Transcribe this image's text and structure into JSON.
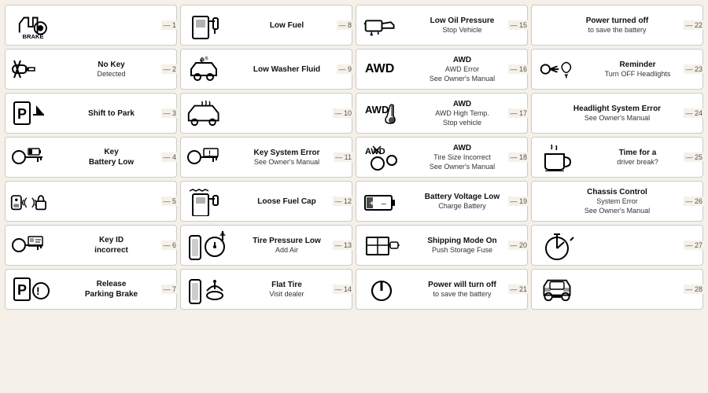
{
  "columns": [
    {
      "items": [
        {
          "id": 1,
          "icon": "brake",
          "label": "BRAKE",
          "sub": ""
        },
        {
          "id": 2,
          "icon": "nokey",
          "label": "No Key",
          "sub": "Detected"
        },
        {
          "id": 3,
          "icon": "park",
          "label": "Shift to Park",
          "sub": ""
        },
        {
          "id": 4,
          "icon": "keybat",
          "label": "Key",
          "sub": "Battery Low"
        },
        {
          "id": 5,
          "icon": "keyfob",
          "label": "",
          "sub": ""
        },
        {
          "id": 6,
          "icon": "keyid",
          "label": "Key ID",
          "sub": "incorrect"
        },
        {
          "id": 7,
          "icon": "parkbrake",
          "label": "Release",
          "sub": "Parking Brake"
        }
      ]
    },
    {
      "items": [
        {
          "id": 8,
          "icon": "fuel",
          "label": "Low Fuel",
          "sub": ""
        },
        {
          "id": 9,
          "icon": "washer",
          "label": "Low Washer Fluid",
          "sub": ""
        },
        {
          "id": 10,
          "icon": "car",
          "label": "",
          "sub": ""
        },
        {
          "id": 11,
          "icon": "keysys",
          "label": "Key System Error",
          "sub": "See Owner's Manual"
        },
        {
          "id": 12,
          "icon": "fuelcap",
          "label": "Loose Fuel Cap",
          "sub": ""
        },
        {
          "id": 13,
          "icon": "tirepres",
          "label": "Tire Pressure Low",
          "sub": "Add Air"
        },
        {
          "id": 14,
          "icon": "flattire",
          "label": "Flat Tire",
          "sub": "Visit dealer"
        }
      ]
    },
    {
      "items": [
        {
          "id": 15,
          "icon": "oilcan",
          "label": "Low Oil Pressure",
          "sub": "Stop Vehicle"
        },
        {
          "id": 16,
          "icon": "awd",
          "label": "AWD",
          "sub": "AWD Error\nSee Owner's Manual"
        },
        {
          "id": 17,
          "icon": "awdhot",
          "label": "AWD",
          "sub": "AWD High Temp.\nStop vehicle"
        },
        {
          "id": 18,
          "icon": "awdsize",
          "label": "AWD",
          "sub": "Tire Size Incorrect\nSee Owner's Manual"
        },
        {
          "id": 19,
          "icon": "battery",
          "label": "Battery Voltage Low",
          "sub": "Charge Battery"
        },
        {
          "id": 20,
          "icon": "ship",
          "label": "Shipping Mode On",
          "sub": "Push Storage Fuse"
        },
        {
          "id": 21,
          "icon": "power",
          "label": "Power will turn off",
          "sub": "to save the battery"
        }
      ]
    },
    {
      "items": [
        {
          "id": 22,
          "icon": "none",
          "label": "Power turned off",
          "sub": "to save the battery"
        },
        {
          "id": 23,
          "icon": "headlights",
          "label": "Reminder",
          "sub": "Turn OFF Headlights"
        },
        {
          "id": 24,
          "icon": "none",
          "label": "Headlight System Error",
          "sub": "See Owner's Manual"
        },
        {
          "id": 25,
          "icon": "coffee",
          "label": "Time for a",
          "sub": "driver break?"
        },
        {
          "id": 26,
          "icon": "none",
          "label": "Chassis Control",
          "sub": "System Error\nSee Owner's Manual"
        },
        {
          "id": 27,
          "icon": "timer",
          "label": "",
          "sub": ""
        },
        {
          "id": 28,
          "icon": "carfront",
          "label": "",
          "sub": ""
        }
      ]
    }
  ]
}
